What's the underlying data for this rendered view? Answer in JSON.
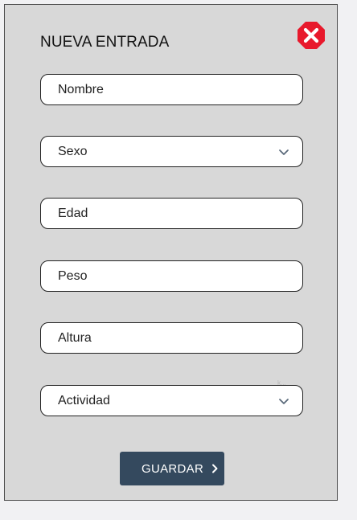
{
  "form": {
    "title": "NUEVA ENTRADA",
    "fields": [
      {
        "placeholder": "Nombre",
        "type": "text"
      },
      {
        "placeholder": "Sexo",
        "type": "select"
      },
      {
        "placeholder": "Edad",
        "type": "text"
      },
      {
        "placeholder": "Peso",
        "type": "text"
      },
      {
        "placeholder": "Altura",
        "type": "text"
      },
      {
        "placeholder": "Actividad",
        "type": "select"
      }
    ],
    "tiny_note": "k...",
    "save_label": "GUARDAR"
  },
  "colors": {
    "panel_bg": "#d8d8d8",
    "close_red": "#e8192c",
    "button_bg": "#34495e",
    "chevron": "#5a6a7a"
  },
  "icons": {
    "close": "close-icon",
    "dropdown": "chevron-down-icon",
    "save": "chevron-right-icon"
  }
}
